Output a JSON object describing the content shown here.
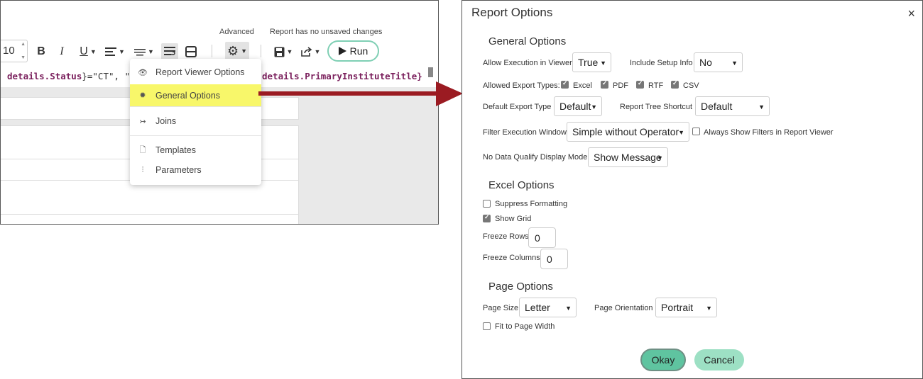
{
  "toolbar": {
    "advanced_label": "Advanced",
    "save_status": "Report has no unsaved changes",
    "font_size": "10",
    "run_label": "Run"
  },
  "code": {
    "part1_var": "details.Status",
    "part1_rest": "}=\"CT\", \"*",
    "part2_var": "details.PrimaryInstituteTitle}"
  },
  "advanced_menu": {
    "items": [
      {
        "label": "Report Viewer Options",
        "icon": "eye-icon"
      },
      {
        "label": "General Options",
        "icon": "gear-icon"
      },
      {
        "label": "Joins",
        "icon": "join-icon"
      },
      {
        "label": "Templates",
        "icon": "document-icon"
      },
      {
        "label": "Parameters",
        "icon": "sliders-icon"
      }
    ],
    "highlight_color": "#f8f76a"
  },
  "dialog": {
    "title": "Report Options",
    "close": "×",
    "general": {
      "heading": "General Options",
      "allow_exec_label": "Allow Execution in Viewer",
      "allow_exec_value": "True",
      "include_setup_label": "Include Setup Info",
      "include_setup_value": "No",
      "allowed_export_label": "Allowed Export Types:",
      "export_types": [
        {
          "label": "Excel",
          "checked": true
        },
        {
          "label": "PDF",
          "checked": true
        },
        {
          "label": "RTF",
          "checked": true
        },
        {
          "label": "CSV",
          "checked": true
        }
      ],
      "default_export_label": "Default Export Type",
      "default_export_value": "Default",
      "tree_shortcut_label": "Report Tree Shortcut",
      "tree_shortcut_value": "Default",
      "filter_window_label": "Filter Execution Window",
      "filter_window_value": "Simple without Operator",
      "always_show_filters_label": "Always Show Filters in Report Viewer",
      "always_show_filters_checked": false,
      "no_data_label": "No Data Qualify Display Mode",
      "no_data_value": "Show Message"
    },
    "excel": {
      "heading": "Excel Options",
      "suppress_label": "Suppress Formatting",
      "suppress_checked": false,
      "show_grid_label": "Show Grid",
      "show_grid_checked": true,
      "freeze_rows_label": "Freeze Rows",
      "freeze_rows_value": "0",
      "freeze_cols_label": "Freeze Columns",
      "freeze_cols_value": "0"
    },
    "page": {
      "heading": "Page Options",
      "size_label": "Page Size",
      "size_value": "Letter",
      "orientation_label": "Page Orientation",
      "orientation_value": "Portrait",
      "fit_width_label": "Fit to Page Width",
      "fit_width_checked": false
    },
    "okay_label": "Okay",
    "cancel_label": "Cancel"
  },
  "colors": {
    "accent": "#5fc4a0",
    "accent_light": "#9de0c4",
    "run_border": "#7fcfb4",
    "arrow": "#9b1b22"
  }
}
